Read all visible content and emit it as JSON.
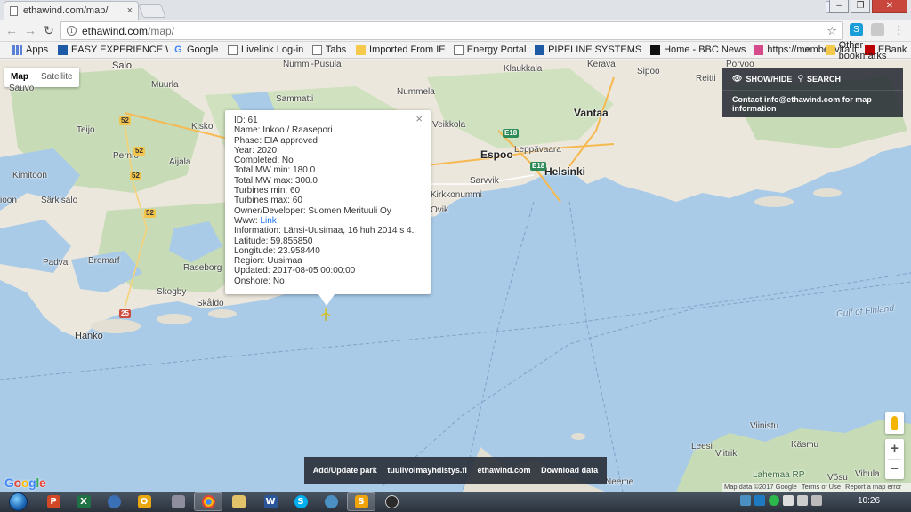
{
  "browser": {
    "tab_title": "ethawind.com/map/",
    "tab_close": "×",
    "url_host": "ethawind.com",
    "url_path": "/map/",
    "bookmarks": [
      {
        "label": "Apps",
        "icon": "apps-icon"
      },
      {
        "label": "EASY EXPERIENCE WE",
        "icon": "site-icon"
      },
      {
        "label": "Google",
        "icon": "google-icon"
      },
      {
        "label": "Livelink Log-in",
        "icon": "page-icon"
      },
      {
        "label": "Tabs",
        "icon": "page-icon"
      },
      {
        "label": "Imported From IE",
        "icon": "folder-icon"
      },
      {
        "label": "Energy Portal",
        "icon": "page-icon"
      },
      {
        "label": "PIPELINE SYSTEMS EN",
        "icon": "site-icon"
      },
      {
        "label": "Home - BBC News",
        "icon": "bbc-icon"
      },
      {
        "label": "https://member.vitalit",
        "icon": "site-icon"
      },
      {
        "label": "EBank",
        "icon": "site-icon"
      }
    ],
    "bookmarks_overflow": "»",
    "other_bookmarks": "Other bookmarks"
  },
  "map": {
    "type_map": "Map",
    "type_satellite": "Satellite",
    "places": {
      "salo": "Salo",
      "muurla": "Muurla",
      "nummi_pusula": "Nummi-Pusula",
      "sammatti": "Sammatti",
      "nummela": "Nummela",
      "klaukkala": "Klaukkala",
      "kerava": "Kerava",
      "sipoo": "Sipoo",
      "porvoo": "Porvoo",
      "reitti": "Reitti",
      "vantaa": "Vantaa",
      "teijo": "Teijo",
      "kisko": "Kisko",
      "veikkola": "Veikkola",
      "espoo": "Espoo",
      "leppavaara": "Leppävaara",
      "helsinki": "Helsinki",
      "pernio": "Perniö",
      "aijala": "Aijala",
      "kimitoon": "Kimitoon",
      "sarvik": "Sarvvik",
      "kirkkonummi": "Kirkkonummi",
      "sarkisalo": "Särkisalo",
      "ovik": "Ovik",
      "toon": "ioon",
      "padva": "Padva",
      "bromarf": "Bromarf",
      "raseborg": "Raseborg",
      "skogby": "Skogby",
      "skaldo": "Skåldö",
      "hanko": "Hanko",
      "gulf": "Gulf of Finland",
      "viinistu": "Viinistu",
      "leesi": "Leesi",
      "viitrik": "Viitrik",
      "kasmu": "Käsmu",
      "lahemaa": "Lahemaa RP",
      "vihula": "Vihula",
      "vosu": "Võsu",
      "neeme": "Neeme",
      "saovu": "Sauvo"
    },
    "shields": [
      "52",
      "52",
      "52",
      "52",
      "25",
      "E18",
      "E18"
    ],
    "info_window": {
      "close": "×",
      "lines": [
        "ID: 61",
        "Name: Inkoo / Raasepori",
        "Phase: EIA approved",
        "Year: 2020",
        "Completed: No",
        "Total MW min: 180.0",
        "Total MW max: 300.0",
        "Turbines min: 60",
        "Turbines max: 60",
        "Owner/Developer: Suomen Merituuli Oy"
      ],
      "www_label": "Www: ",
      "www_link": "Link",
      "lines2": [
        "Information: Länsi-Uusimaa, 16 huh 2014 s 4.",
        "Latitude: 59.855850",
        "Longitude: 23.958440",
        "Region: Uusimaa",
        "Updated: 2017-08-05 00:00:00",
        "Onshore: No"
      ]
    },
    "panel": {
      "show_hide": "SHOW/HIDE",
      "search": "SEARCH",
      "contact": "Contact info@ethawind.com for map information"
    },
    "bottom_bar": [
      "Add/Update park",
      "tuulivoimayhdistys.fi",
      "ethawind.com",
      "Download data"
    ],
    "google_logo": "Google",
    "attribution": [
      "Map data ©2017 Google",
      "Terms of Use",
      "Report a map error"
    ],
    "zoom_in": "+",
    "zoom_out": "−"
  },
  "taskbar": {
    "clock": "10:26"
  },
  "colors": {
    "water": "#a9cbe8",
    "land": "#ece7dc",
    "forest": "#c7dcb6",
    "panel": "#282d36",
    "link": "#1a73e8"
  }
}
